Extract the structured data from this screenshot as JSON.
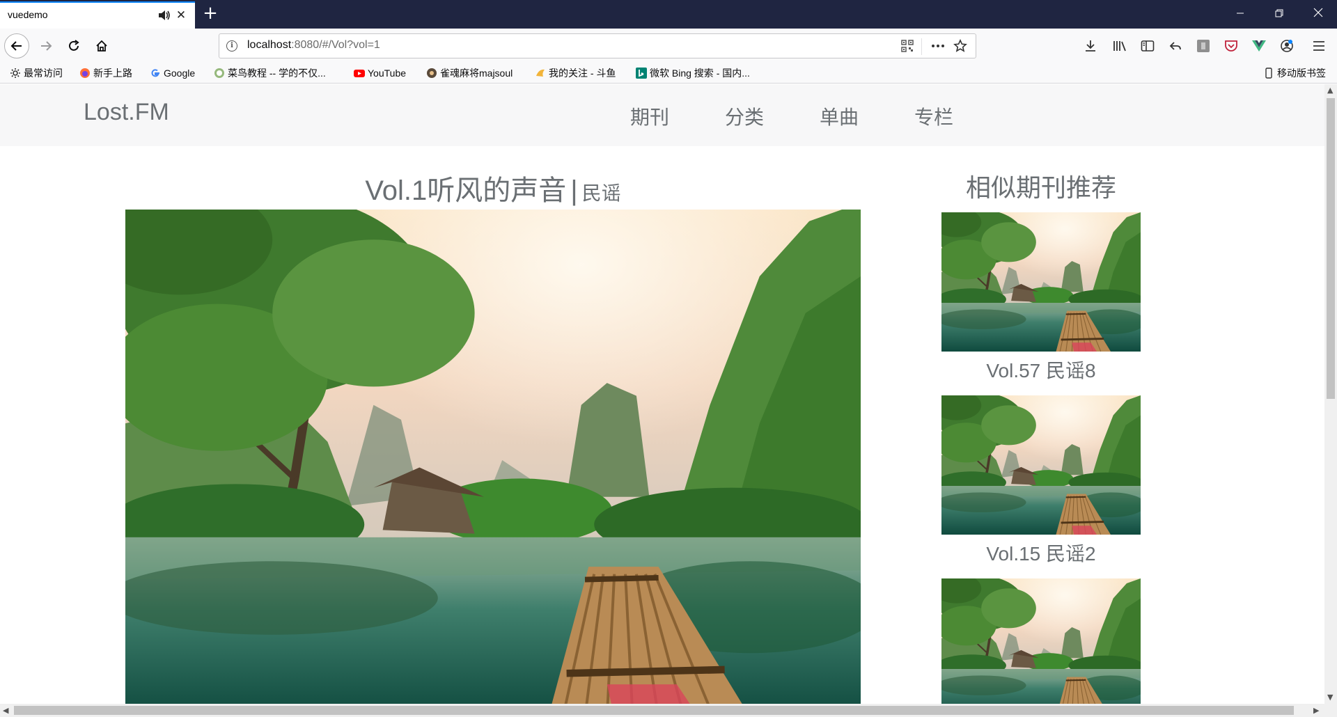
{
  "browser": {
    "tab_title": "vuedemo",
    "url_host": "localhost",
    "url_rest": ":8080/#/Vol?vol=1",
    "bookmarks": [
      "最常访问",
      "新手上路",
      "Google",
      "菜鸟教程 -- 学的不仅...",
      "YouTube",
      "雀魂麻将majsoul",
      "我的关注 - 斗鱼",
      "微软 Bing 搜索 - 国内...",
      "移动版书签"
    ],
    "icons": {
      "tab_audio": "speaker-icon",
      "tab_close": "close-icon",
      "new_tab": "plus-icon",
      "back": "back-arrow-icon",
      "forward": "forward-arrow-icon",
      "reload": "reload-icon",
      "home": "home-icon",
      "page_info": "info-icon",
      "qr": "qr-code-icon",
      "page_actions": "more-icon",
      "star": "star-icon",
      "download": "download-icon",
      "library": "library-icon",
      "sidebar": "sidebar-icon"
    }
  },
  "site": {
    "logo": "Lost.FM",
    "nav": [
      "期刊",
      "分类",
      "单曲",
      "专栏"
    ]
  },
  "vol": {
    "title": "Vol.1听风的声音",
    "separator": "|",
    "category": "民谣"
  },
  "recommend": {
    "title": "相似期刊推荐",
    "items": [
      {
        "label": "Vol.57 民谣8"
      },
      {
        "label": "Vol.15 民谣2"
      },
      {
        "label": ""
      }
    ]
  },
  "colors": {
    "titlebar": "#1f2541",
    "accent": "#0a84ff",
    "text_gray": "#6a6f73"
  }
}
